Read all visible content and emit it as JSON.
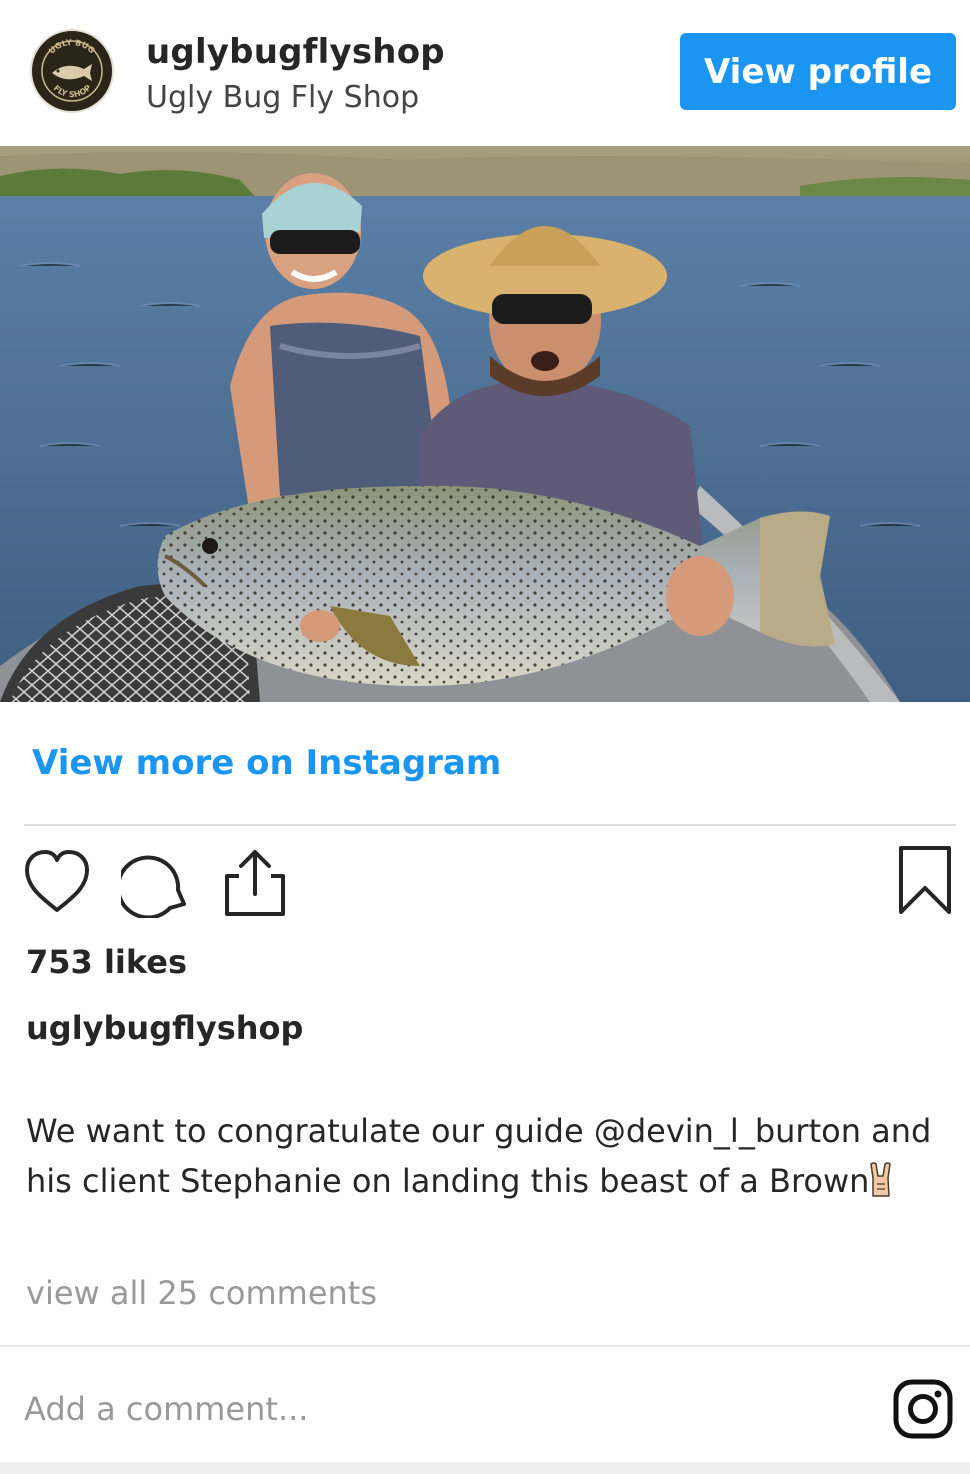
{
  "header": {
    "username": "uglybugflyshop",
    "full_name": "Ugly Bug Fly Shop",
    "view_profile_label": "View profile",
    "avatar_icon": "ugly-bug-logo",
    "avatar_text_top": "UGLY BUG",
    "avatar_text_bottom": "FLY SHOP"
  },
  "post": {
    "view_more_label": "View more on Instagram",
    "actions": {
      "like_icon": "heart-icon",
      "comment_icon": "comment-bubble-icon",
      "share_icon": "share-icon",
      "save_icon": "bookmark-icon"
    },
    "likes": "753 likes",
    "caption_username": "uglybugflyshop",
    "caption_text": "We want to congratulate our guide @devin_l_burton and his client Stephanie on landing this beast of a Brown",
    "caption_emoji": "sign-of-the-horns-emoji",
    "view_comments_label": "view all 25 comments"
  },
  "comment_box": {
    "placeholder": "Add a comment...",
    "instagram_icon": "instagram-logo-icon"
  },
  "colors": {
    "accent_blue": "#1a95f2",
    "text_primary": "#262626",
    "text_muted": "#999999",
    "divider": "#dbdbdb"
  }
}
